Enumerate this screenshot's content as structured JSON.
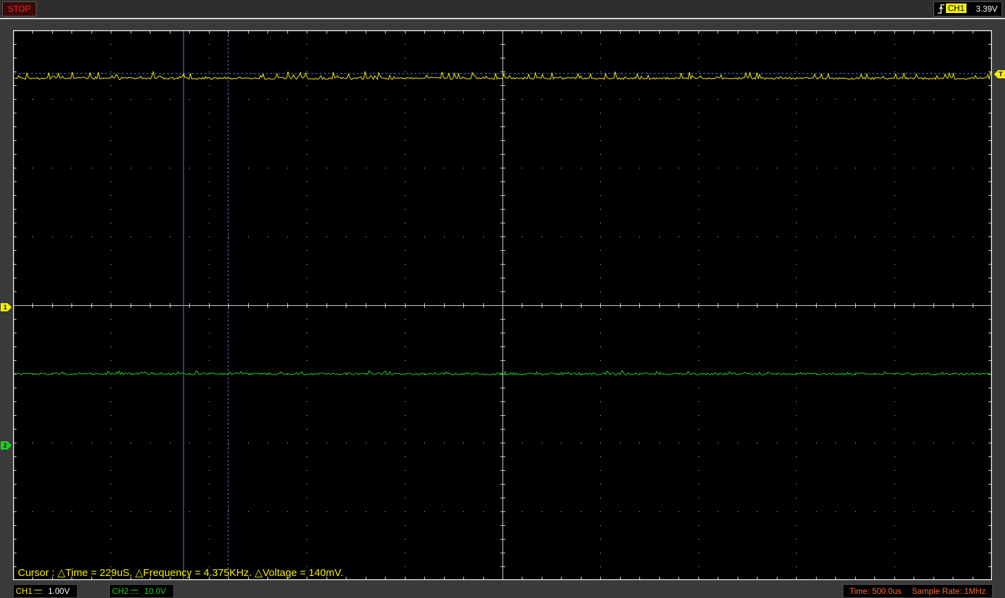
{
  "status": {
    "run_state": "STOP"
  },
  "trigger": {
    "channel": "CH1",
    "level": "3.39V",
    "edge_icon": "rising-edge-icon"
  },
  "scope": {
    "grid_divisions": {
      "horizontal": 10,
      "vertical": 8
    },
    "colors": {
      "ch1": "#f4f000",
      "ch2": "#1fd11f",
      "cursor": "#4f86d6",
      "trigger": "#4f86d6",
      "grid": "#d0d0d0",
      "background": "#000000"
    }
  },
  "markers": {
    "ch1": "1",
    "ch2": "2",
    "trigger": "T"
  },
  "cursor_readout": {
    "text": "Cursor : △Time = 229uS. △Frequency = 4.375KHz. △Voltage = 140mV."
  },
  "channels": [
    {
      "name": "CH1",
      "scale": "1.00V",
      "color": "#f4f000"
    },
    {
      "name": "CH2",
      "scale": "10.0V",
      "color": "#1fd11f"
    }
  ],
  "acquisition": {
    "time": "Time: 500.0us",
    "sample_rate": "Sample Rate: 1MHz"
  }
}
